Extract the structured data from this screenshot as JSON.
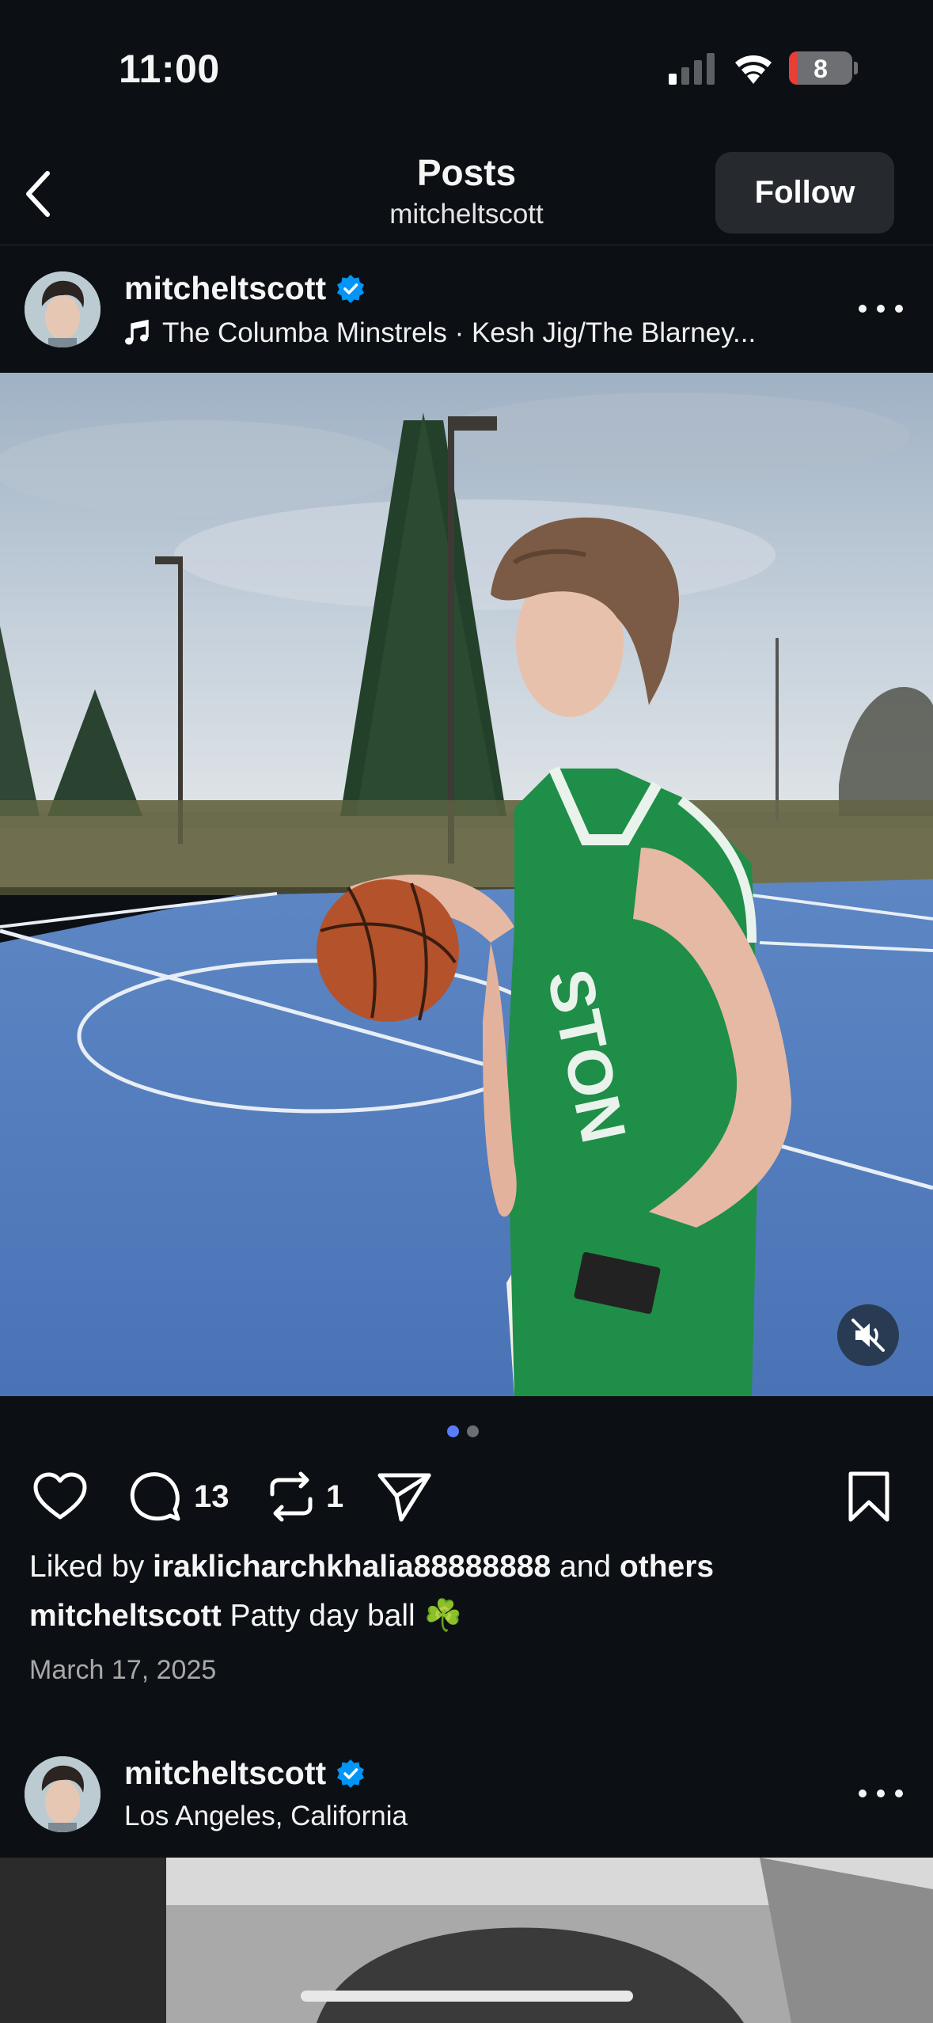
{
  "status_bar": {
    "time": "11:00",
    "battery": "8"
  },
  "header": {
    "back_icon": "chevron-left-icon",
    "title": "Posts",
    "subtitle": "mitcheltscott",
    "follow_label": "Follow"
  },
  "post1": {
    "username": "mitcheltscott",
    "verified": true,
    "music_icon": "music-note-icon",
    "audio": "The Columba Minstrels · Kesh Jig/The Blarney...",
    "carousel": {
      "total": 2,
      "current": 1
    },
    "comment_count": "13",
    "repost_count": "1",
    "liked_by_prefix": "Liked by",
    "liked_by_user": "iraklicharchkhalia88888888",
    "liked_by_and": "and",
    "liked_by_others": "others",
    "caption_user": "mitcheltscott",
    "caption_text": "Patty day ball",
    "caption_emoji": "☘️",
    "date": "March 17, 2025"
  },
  "post2": {
    "username": "mitcheltscott",
    "verified": true,
    "location": "Los Angeles, California"
  },
  "colors": {
    "background": "#0c1014",
    "verified_blue": "#0095f6",
    "carousel_active": "#5b7cfa",
    "carousel_inactive": "#6b6f75",
    "follow_bg": "#262a2f"
  }
}
